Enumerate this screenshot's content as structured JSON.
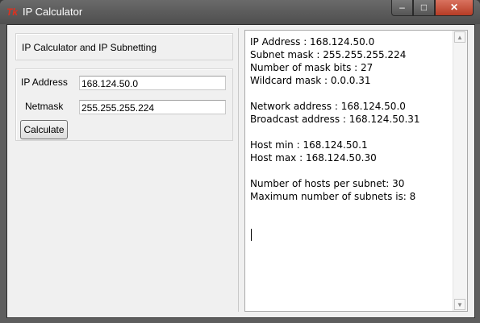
{
  "window": {
    "title": "IP Calculator",
    "icon": "tk-feather-icon",
    "minimize": "–",
    "maximize": "□",
    "close": "✕"
  },
  "heading": "IP Calculator and IP Subnetting",
  "form": {
    "ip_label": "IP Address",
    "ip_value": "168.124.50.0",
    "netmask_label": "Netmask",
    "netmask_value": "255.255.255.224",
    "calculate_label": "Calculate"
  },
  "output": {
    "lines": [
      "IP Address : 168.124.50.0",
      "Subnet mask : 255.255.255.224",
      "Number of mask bits : 27",
      "Wildcard mask : 0.0.0.31",
      "",
      "Network address : 168.124.50.0",
      "Broadcast address : 168.124.50.31",
      "",
      "Host min : 168.124.50.1",
      "Host max : 168.124.50.30",
      "",
      "Number of hosts per subnet: 30",
      "Maximum number of subnets is: 8"
    ]
  },
  "scrollbar": {
    "up": "▲",
    "down": "▼"
  }
}
